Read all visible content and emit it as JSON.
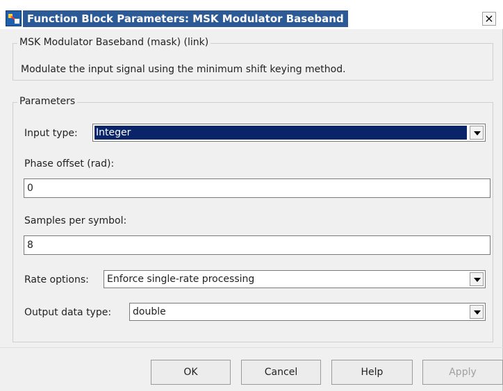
{
  "window": {
    "title": "Function Block Parameters: MSK Modulator Baseband",
    "close_label": "×"
  },
  "mask": {
    "legend": "MSK Modulator Baseband (mask) (link)",
    "description": "Modulate the input signal using the minimum shift keying method."
  },
  "parameters": {
    "legend": "Parameters",
    "input_type": {
      "label": "Input type:",
      "value": "Integer"
    },
    "phase_offset": {
      "label": "Phase offset (rad):",
      "value": "0"
    },
    "samples_per_symbol": {
      "label": "Samples per symbol:",
      "value": "8"
    },
    "rate_options": {
      "label": "Rate options:",
      "value": "Enforce single-rate processing"
    },
    "output_data_type": {
      "label": "Output data type:",
      "value": "double"
    }
  },
  "buttons": {
    "ok": "OK",
    "cancel": "Cancel",
    "help": "Help",
    "apply": "Apply"
  }
}
